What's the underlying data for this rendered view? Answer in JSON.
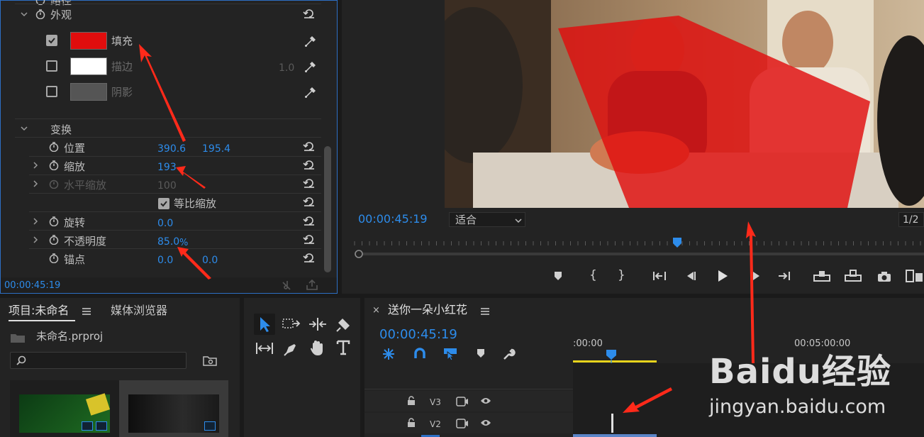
{
  "effect_controls": {
    "partial_label": "路径",
    "appearance": {
      "label": "外观",
      "fill": {
        "label": "填充",
        "checked": true,
        "color": "#e00d0d"
      },
      "stroke": {
        "label": "描边",
        "checked": false,
        "color": "#ffffff",
        "value": "1.0"
      },
      "shadow": {
        "label": "阴影",
        "checked": false,
        "color": "#555555"
      }
    },
    "transform": {
      "label": "变换",
      "position": {
        "label": "位置",
        "x": "390.6",
        "y": "195.4"
      },
      "scale": {
        "label": "缩放",
        "value": "193"
      },
      "scale_width": {
        "label": "水平缩放",
        "value": "100"
      },
      "uniform": {
        "label": "等比缩放",
        "checked": true
      },
      "rotation": {
        "label": "旋转",
        "value": "0.0"
      },
      "opacity": {
        "label": "不透明度",
        "value": "85.0",
        "unit": "%"
      },
      "anchor": {
        "label": "锚点",
        "x": "0.0",
        "y": "0.0"
      }
    },
    "timecode": "00:00:45:19"
  },
  "program_monitor": {
    "timecode": "00:00:45:19",
    "fit": "适合",
    "resolution": "1/2",
    "playhead_fraction": 0.54
  },
  "project": {
    "tab_project": "项目:未命名",
    "tab_media": "媒体浏览器",
    "file": "未命名.prproj"
  },
  "timeline": {
    "name": "送你一朵小红花",
    "timecode": "00:00:45:19",
    "ruler_start": ":00:00",
    "ruler_mark": "00:05:00:00",
    "tracks": [
      {
        "name": "V3"
      },
      {
        "name": "V2"
      }
    ]
  },
  "watermark": {
    "brand": "Baidu经验",
    "url": "jingyan.baidu.com"
  },
  "colors": {
    "accent": "#2d8ceb",
    "fill_red": "#e00d0d",
    "annotation_red": "#ff2a1a",
    "work_area": "#e8d41c"
  }
}
